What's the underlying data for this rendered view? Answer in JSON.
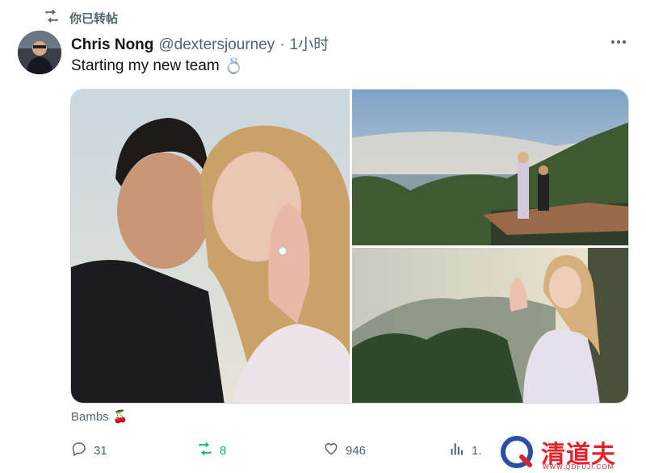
{
  "repost_banner": {
    "text": "你已转帖"
  },
  "author": {
    "name": "Chris Nong",
    "handle": "@dextersjourney",
    "separator": "·",
    "time": "1小时"
  },
  "tweet": {
    "text": "Starting my new team",
    "emoji": "💍"
  },
  "media": {
    "photo_count": 3
  },
  "caption": {
    "text": "Bambs",
    "emoji": "🍒"
  },
  "actions": {
    "replies": "31",
    "reposts": "8",
    "likes": "946",
    "views": "1."
  },
  "colors": {
    "repost_green": "#00ba7c",
    "secondary_text": "#536471",
    "watermark_red": "#e62129"
  },
  "watermark": {
    "text": "清道夫",
    "url": "WWW.QDFUJI.COM"
  },
  "icons": {
    "repost": "repost-icon",
    "more": "more-icon",
    "reply": "reply-icon",
    "like": "heart-icon",
    "views": "views-icon"
  }
}
